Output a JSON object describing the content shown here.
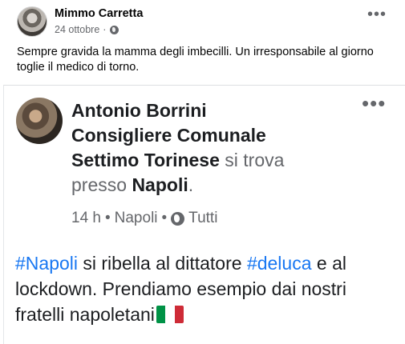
{
  "post": {
    "author": "Mimmo Carretta",
    "date": "24 ottobre",
    "separator": "·",
    "text": "Sempre gravida la mamma degli imbecilli. Un irresponsabile  al giorno toglie il medico di torno.",
    "more_icon": "more-options-icon",
    "privacy_icon": "globe-icon"
  },
  "embedded": {
    "author_name": "Antonio Borrini",
    "author_line2": "Consigliere Comunale",
    "author_line3": "Settimo Torinese",
    "checkin_prefix": "si trova",
    "checkin_at": "presso",
    "place": "Napoli",
    "place_suffix": ".",
    "time": "14 h",
    "dot": "•",
    "location": "Napoli",
    "audience": "Tutti",
    "hashtag1": "#Napoli",
    "text1": " si ribella al dittatore ",
    "hashtag2": "#deluca",
    "text2": " e al lockdown. Prendiamo esempio dai nostri fratelli napoletani",
    "flag_colors": [
      "#009246",
      "#ffffff",
      "#ce2b37"
    ]
  }
}
